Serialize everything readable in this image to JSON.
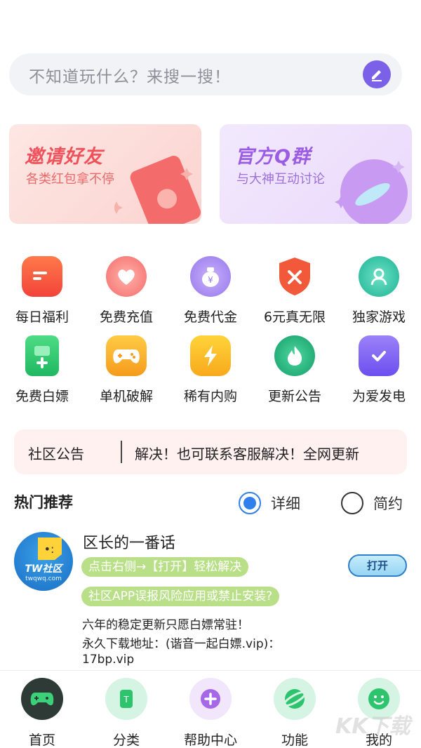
{
  "search": {
    "placeholder": "不知道玩什么？来搜一搜！"
  },
  "banners": [
    {
      "title": "邀请好友",
      "subtitle": "各类红包拿不停"
    },
    {
      "title": "官方Q群",
      "subtitle": "与大神互动讨论"
    }
  ],
  "grid": [
    {
      "label": "每日福利",
      "icon": "folder-icon",
      "color": "#f2533f"
    },
    {
      "label": "免费充值",
      "icon": "heart-icon",
      "color": "#f46b6b"
    },
    {
      "label": "免费代金",
      "icon": "money-bag-icon",
      "color": "#a07cf0"
    },
    {
      "label": "6元真无限",
      "icon": "shield-icon",
      "color": "#f26b3a"
    },
    {
      "label": "独家游戏",
      "icon": "user-icon",
      "color": "#22b89a"
    },
    {
      "label": "免费白嫖",
      "icon": "phone-plus-icon",
      "color": "#2ec46e"
    },
    {
      "label": "单机破解",
      "icon": "gamepad-icon",
      "color": "#f7a928"
    },
    {
      "label": "稀有内购",
      "icon": "lightning-icon",
      "color": "#f8be1e"
    },
    {
      "label": "更新公告",
      "icon": "flame-icon",
      "color": "#1fae78"
    },
    {
      "label": "为爱发电",
      "icon": "check-icon",
      "color": "#7c5ff0"
    }
  ],
  "notice": {
    "label": "社区公告",
    "text": "解决！也可联系客服解决！全网更新"
  },
  "recommend": {
    "title": "热门推荐",
    "option_detail": "详细",
    "option_simple": "简约"
  },
  "post": {
    "logo_text": "TW社区",
    "logo_sub": "twqwq.com",
    "title": "区长的一番话",
    "tag1": "点击右侧→【打开】轻松解决",
    "tag2": "社区APP误报风险应用或禁止安装?",
    "open_label": "打开",
    "line1": "六年的稳定更新只愿白嫖常驻！",
    "line2": "永久下载地址：(谐音一起白嫖.vip)：",
    "line3": "17bp.vip"
  },
  "tabs": [
    {
      "label": "首页",
      "icon": "gamepad-icon"
    },
    {
      "label": "分类",
      "icon": "category-icon"
    },
    {
      "label": "帮助中心",
      "icon": "plus-icon"
    },
    {
      "label": "功能",
      "icon": "planet-icon"
    },
    {
      "label": "我的",
      "icon": "profile-icon"
    }
  ],
  "watermark": "KK下载"
}
